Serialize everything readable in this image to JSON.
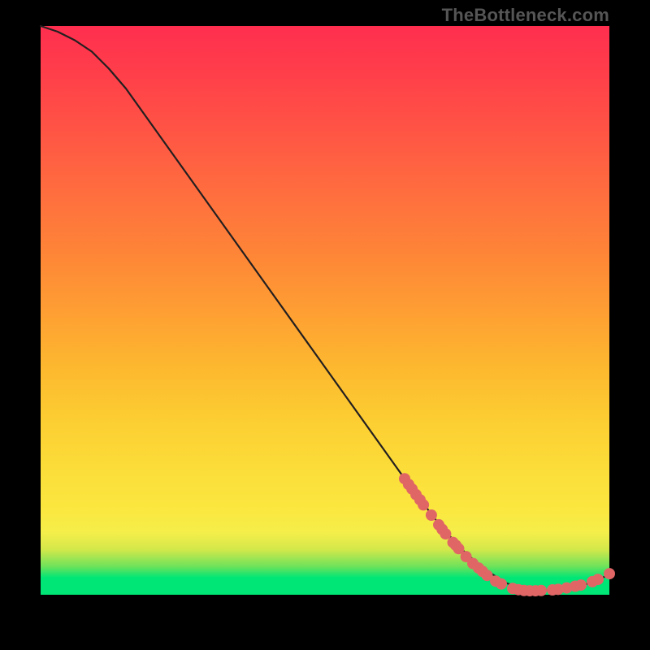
{
  "attribution": "TheBottleneck.com",
  "chart_data": {
    "type": "line",
    "title": "",
    "xlabel": "",
    "ylabel": "",
    "xlim": [
      0,
      100
    ],
    "ylim": [
      0,
      100
    ],
    "curve": [
      {
        "x": 0.0,
        "y": 100.0
      },
      {
        "x": 3.0,
        "y": 99.0
      },
      {
        "x": 6.0,
        "y": 97.5
      },
      {
        "x": 9.0,
        "y": 95.5
      },
      {
        "x": 12.0,
        "y": 92.5
      },
      {
        "x": 15.0,
        "y": 89.0
      },
      {
        "x": 20.0,
        "y": 82.0
      },
      {
        "x": 30.0,
        "y": 68.0
      },
      {
        "x": 40.0,
        "y": 54.0
      },
      {
        "x": 50.0,
        "y": 40.0
      },
      {
        "x": 60.0,
        "y": 26.0
      },
      {
        "x": 65.0,
        "y": 19.0
      },
      {
        "x": 70.0,
        "y": 12.5
      },
      {
        "x": 74.0,
        "y": 8.0
      },
      {
        "x": 78.0,
        "y": 4.5
      },
      {
        "x": 82.0,
        "y": 2.0
      },
      {
        "x": 86.0,
        "y": 0.8
      },
      {
        "x": 90.0,
        "y": 0.8
      },
      {
        "x": 95.0,
        "y": 1.5
      },
      {
        "x": 100.0,
        "y": 3.5
      }
    ],
    "scatter_lower": [
      {
        "x": 64.0,
        "y": 20.4
      },
      {
        "x": 64.7,
        "y": 19.4
      },
      {
        "x": 65.3,
        "y": 18.6
      },
      {
        "x": 66.0,
        "y": 17.6
      },
      {
        "x": 66.7,
        "y": 16.7
      },
      {
        "x": 67.3,
        "y": 15.8
      },
      {
        "x": 68.7,
        "y": 14.0
      },
      {
        "x": 70.0,
        "y": 12.3
      },
      {
        "x": 70.6,
        "y": 11.5
      },
      {
        "x": 71.2,
        "y": 10.7
      },
      {
        "x": 72.5,
        "y": 9.2
      },
      {
        "x": 73.0,
        "y": 8.7
      },
      {
        "x": 73.5,
        "y": 8.1
      },
      {
        "x": 74.8,
        "y": 6.7
      },
      {
        "x": 76.0,
        "y": 5.5
      },
      {
        "x": 77.0,
        "y": 4.7
      },
      {
        "x": 77.7,
        "y": 4.1
      },
      {
        "x": 78.5,
        "y": 3.4
      },
      {
        "x": 80.0,
        "y": 2.4
      },
      {
        "x": 81.0,
        "y": 1.9
      },
      {
        "x": 83.0,
        "y": 1.1
      },
      {
        "x": 84.0,
        "y": 0.9
      },
      {
        "x": 85.0,
        "y": 0.75
      },
      {
        "x": 86.0,
        "y": 0.7
      },
      {
        "x": 87.0,
        "y": 0.7
      },
      {
        "x": 88.0,
        "y": 0.75
      },
      {
        "x": 90.0,
        "y": 0.85
      },
      {
        "x": 91.0,
        "y": 0.95
      },
      {
        "x": 92.5,
        "y": 1.2
      },
      {
        "x": 94.0,
        "y": 1.5
      },
      {
        "x": 95.0,
        "y": 1.7
      },
      {
        "x": 97.0,
        "y": 2.3
      },
      {
        "x": 98.0,
        "y": 2.7
      },
      {
        "x": 100.0,
        "y": 3.7
      }
    ]
  }
}
